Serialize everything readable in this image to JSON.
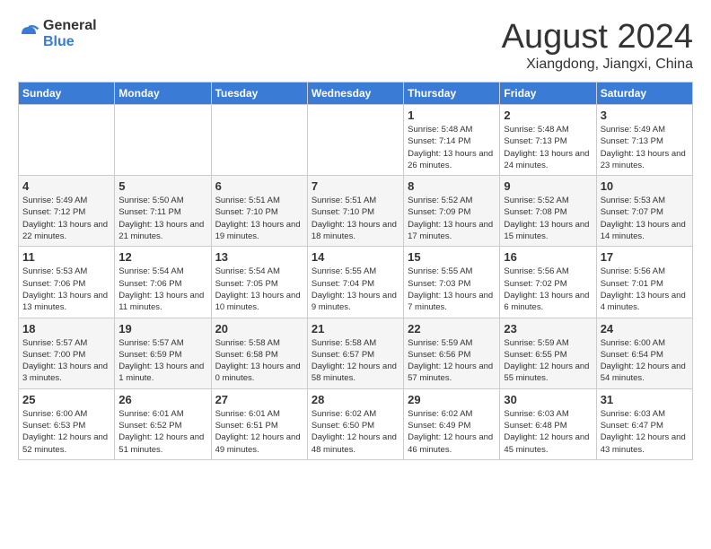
{
  "logo": {
    "general": "General",
    "blue": "Blue"
  },
  "header": {
    "month": "August 2024",
    "location": "Xiangdong, Jiangxi, China"
  },
  "weekdays": [
    "Sunday",
    "Monday",
    "Tuesday",
    "Wednesday",
    "Thursday",
    "Friday",
    "Saturday"
  ],
  "weeks": [
    [
      {
        "day": "",
        "detail": ""
      },
      {
        "day": "",
        "detail": ""
      },
      {
        "day": "",
        "detail": ""
      },
      {
        "day": "",
        "detail": ""
      },
      {
        "day": "1",
        "detail": "Sunrise: 5:48 AM\nSunset: 7:14 PM\nDaylight: 13 hours and 26 minutes."
      },
      {
        "day": "2",
        "detail": "Sunrise: 5:48 AM\nSunset: 7:13 PM\nDaylight: 13 hours and 24 minutes."
      },
      {
        "day": "3",
        "detail": "Sunrise: 5:49 AM\nSunset: 7:13 PM\nDaylight: 13 hours and 23 minutes."
      }
    ],
    [
      {
        "day": "4",
        "detail": "Sunrise: 5:49 AM\nSunset: 7:12 PM\nDaylight: 13 hours and 22 minutes."
      },
      {
        "day": "5",
        "detail": "Sunrise: 5:50 AM\nSunset: 7:11 PM\nDaylight: 13 hours and 21 minutes."
      },
      {
        "day": "6",
        "detail": "Sunrise: 5:51 AM\nSunset: 7:10 PM\nDaylight: 13 hours and 19 minutes."
      },
      {
        "day": "7",
        "detail": "Sunrise: 5:51 AM\nSunset: 7:10 PM\nDaylight: 13 hours and 18 minutes."
      },
      {
        "day": "8",
        "detail": "Sunrise: 5:52 AM\nSunset: 7:09 PM\nDaylight: 13 hours and 17 minutes."
      },
      {
        "day": "9",
        "detail": "Sunrise: 5:52 AM\nSunset: 7:08 PM\nDaylight: 13 hours and 15 minutes."
      },
      {
        "day": "10",
        "detail": "Sunrise: 5:53 AM\nSunset: 7:07 PM\nDaylight: 13 hours and 14 minutes."
      }
    ],
    [
      {
        "day": "11",
        "detail": "Sunrise: 5:53 AM\nSunset: 7:06 PM\nDaylight: 13 hours and 13 minutes."
      },
      {
        "day": "12",
        "detail": "Sunrise: 5:54 AM\nSunset: 7:06 PM\nDaylight: 13 hours and 11 minutes."
      },
      {
        "day": "13",
        "detail": "Sunrise: 5:54 AM\nSunset: 7:05 PM\nDaylight: 13 hours and 10 minutes."
      },
      {
        "day": "14",
        "detail": "Sunrise: 5:55 AM\nSunset: 7:04 PM\nDaylight: 13 hours and 9 minutes."
      },
      {
        "day": "15",
        "detail": "Sunrise: 5:55 AM\nSunset: 7:03 PM\nDaylight: 13 hours and 7 minutes."
      },
      {
        "day": "16",
        "detail": "Sunrise: 5:56 AM\nSunset: 7:02 PM\nDaylight: 13 hours and 6 minutes."
      },
      {
        "day": "17",
        "detail": "Sunrise: 5:56 AM\nSunset: 7:01 PM\nDaylight: 13 hours and 4 minutes."
      }
    ],
    [
      {
        "day": "18",
        "detail": "Sunrise: 5:57 AM\nSunset: 7:00 PM\nDaylight: 13 hours and 3 minutes."
      },
      {
        "day": "19",
        "detail": "Sunrise: 5:57 AM\nSunset: 6:59 PM\nDaylight: 13 hours and 1 minute."
      },
      {
        "day": "20",
        "detail": "Sunrise: 5:58 AM\nSunset: 6:58 PM\nDaylight: 13 hours and 0 minutes."
      },
      {
        "day": "21",
        "detail": "Sunrise: 5:58 AM\nSunset: 6:57 PM\nDaylight: 12 hours and 58 minutes."
      },
      {
        "day": "22",
        "detail": "Sunrise: 5:59 AM\nSunset: 6:56 PM\nDaylight: 12 hours and 57 minutes."
      },
      {
        "day": "23",
        "detail": "Sunrise: 5:59 AM\nSunset: 6:55 PM\nDaylight: 12 hours and 55 minutes."
      },
      {
        "day": "24",
        "detail": "Sunrise: 6:00 AM\nSunset: 6:54 PM\nDaylight: 12 hours and 54 minutes."
      }
    ],
    [
      {
        "day": "25",
        "detail": "Sunrise: 6:00 AM\nSunset: 6:53 PM\nDaylight: 12 hours and 52 minutes."
      },
      {
        "day": "26",
        "detail": "Sunrise: 6:01 AM\nSunset: 6:52 PM\nDaylight: 12 hours and 51 minutes."
      },
      {
        "day": "27",
        "detail": "Sunrise: 6:01 AM\nSunset: 6:51 PM\nDaylight: 12 hours and 49 minutes."
      },
      {
        "day": "28",
        "detail": "Sunrise: 6:02 AM\nSunset: 6:50 PM\nDaylight: 12 hours and 48 minutes."
      },
      {
        "day": "29",
        "detail": "Sunrise: 6:02 AM\nSunset: 6:49 PM\nDaylight: 12 hours and 46 minutes."
      },
      {
        "day": "30",
        "detail": "Sunrise: 6:03 AM\nSunset: 6:48 PM\nDaylight: 12 hours and 45 minutes."
      },
      {
        "day": "31",
        "detail": "Sunrise: 6:03 AM\nSunset: 6:47 PM\nDaylight: 12 hours and 43 minutes."
      }
    ]
  ]
}
